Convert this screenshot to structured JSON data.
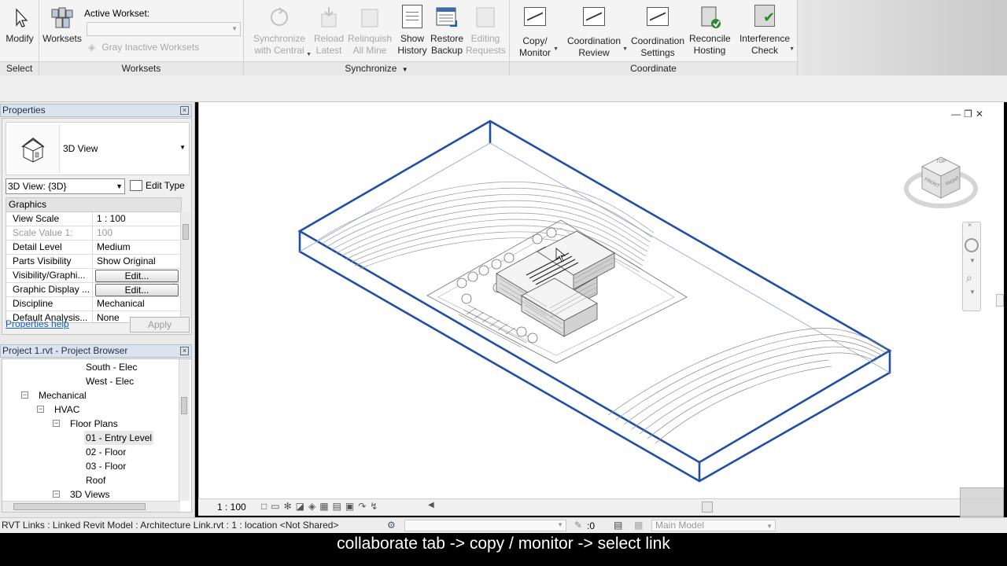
{
  "ribbon": {
    "select_panel": {
      "modify_label": "Modify",
      "panel_label": "Select"
    },
    "worksets_panel": {
      "worksets_label": "Worksets",
      "active_workset_label": "Active Workset:",
      "active_workset_value": "",
      "gray_inactive_label": "Gray Inactive Worksets",
      "panel_label": "Worksets"
    },
    "synchronize_panel": {
      "sync_label_1": "Synchronize",
      "sync_label_2": "with Central",
      "reload_label_1": "Reload",
      "reload_label_2": "Latest",
      "relinquish_label_1": "Relinquish",
      "relinquish_label_2": "All Mine",
      "history_label_1": "Show",
      "history_label_2": "History",
      "restore_label_1": "Restore",
      "restore_label_2": "Backup",
      "editing_label_1": "Editing",
      "editing_label_2": "Requests",
      "panel_label": "Synchronize"
    },
    "coordinate_panel": {
      "copy_label_1": "Copy/",
      "copy_label_2": "Monitor",
      "review_label_1": "Coordination",
      "review_label_2": "Review",
      "settings_label_1": "Coordination",
      "settings_label_2": "Settings",
      "reconcile_label_1": "Reconcile",
      "reconcile_label_2": "Hosting",
      "interference_label_1": "Interference",
      "interference_label_2": "Check",
      "panel_label": "Coordinate"
    }
  },
  "properties": {
    "title": "Properties",
    "type_name": "3D View",
    "view_selector": "3D View: {3D}",
    "edit_type": "Edit Type",
    "group": "Graphics",
    "rows": [
      {
        "name": "View Scale",
        "value": "1 : 100"
      },
      {
        "name": "Scale Value    1:",
        "value": "100"
      },
      {
        "name": "Detail Level",
        "value": "Medium"
      },
      {
        "name": "Parts Visibility",
        "value": "Show Original"
      },
      {
        "name": "Visibility/Graphi...",
        "value": "Edit..."
      },
      {
        "name": "Graphic Display ...",
        "value": "Edit..."
      },
      {
        "name": "Discipline",
        "value": "Mechanical"
      },
      {
        "name": "Default Analysis...",
        "value": "None"
      }
    ],
    "help_link": "Properties help",
    "apply_label": "Apply"
  },
  "project_browser": {
    "title": "Project 1.rvt - Project Browser",
    "items": [
      {
        "label": "South - Elec"
      },
      {
        "label": "West - Elec"
      },
      {
        "label": "Mechanical"
      },
      {
        "label": "HVAC"
      },
      {
        "label": "Floor Plans"
      },
      {
        "label": "01 - Entry Level"
      },
      {
        "label": "02 - Floor"
      },
      {
        "label": "03 - Floor"
      },
      {
        "label": "Roof"
      },
      {
        "label": "3D Views"
      }
    ]
  },
  "view_control": {
    "scale": "1 : 100"
  },
  "status_bar": {
    "message": "RVT Links : Linked Revit Model : Architecture Link.rvt : 1 : location <Not Shared>",
    "filter_count": ":0",
    "model": "Main Model"
  },
  "viewcube": {
    "top_label": "TOP",
    "front_label": "FRONT",
    "right_label": "RIGHT"
  },
  "caption": "collaborate tab -> copy / monitor -> select link",
  "colors": {
    "model_outline": "#1f4fa6",
    "accent_link": "#1a5fb4"
  }
}
